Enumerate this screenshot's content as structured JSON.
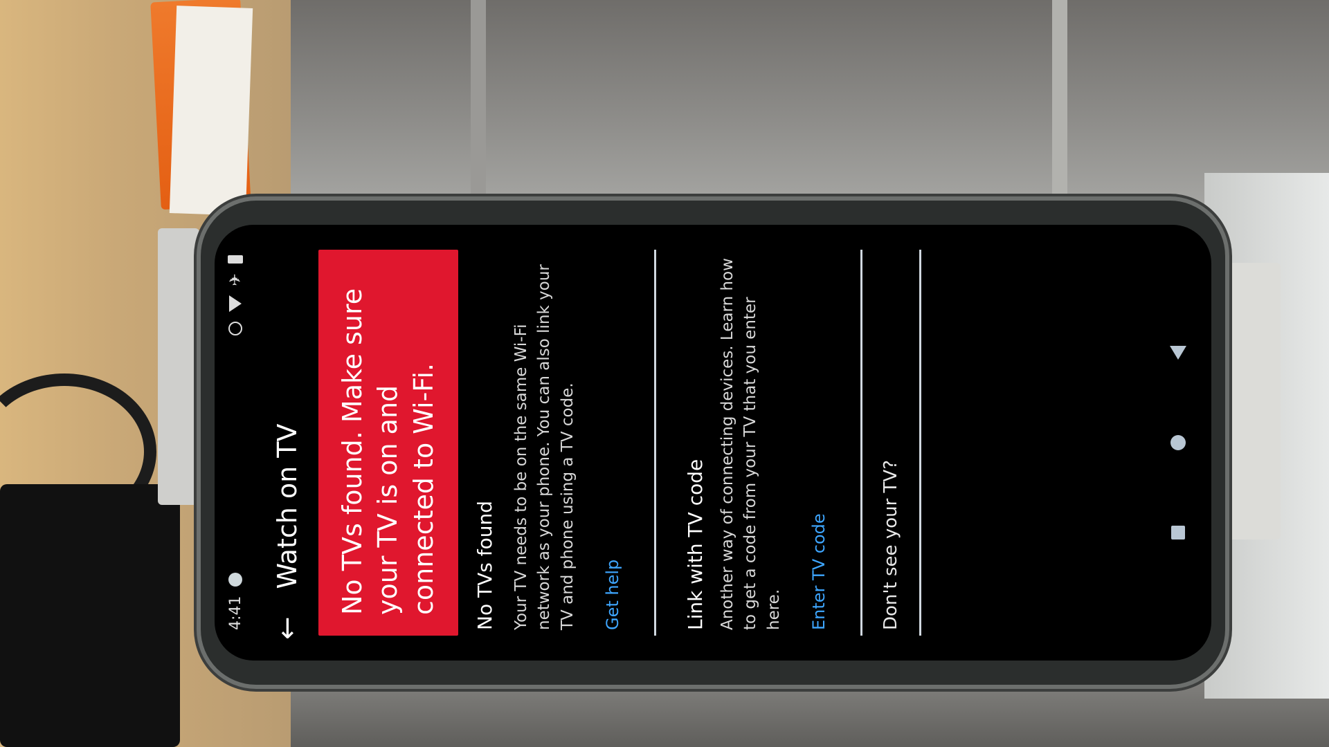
{
  "status_bar": {
    "time": "4:41"
  },
  "app_bar": {
    "title": "Watch on TV"
  },
  "banner": {
    "text": "No TVs found. Make sure your TV is on and connected to Wi-Fi.",
    "color": "#e0172e"
  },
  "no_tvs": {
    "heading": "No TVs found",
    "body": "Your TV needs to be on the same Wi-Fi network as your phone. You can also link your TV and phone using a TV code.",
    "link": "Get help"
  },
  "tv_code": {
    "heading": "Link with TV code",
    "body": "Another way of connecting devices. Learn how to get a code from your TV that you enter here.",
    "link": "Enter TV code"
  },
  "dont_see": {
    "text": "Don't see your TV?"
  },
  "icons": {
    "back": "back-arrow-icon",
    "nav_back": "nav-back-icon",
    "nav_home": "nav-home-icon",
    "nav_recents": "nav-recents-icon"
  },
  "colors": {
    "link": "#3ea6ff",
    "screen_background": "#000000"
  }
}
